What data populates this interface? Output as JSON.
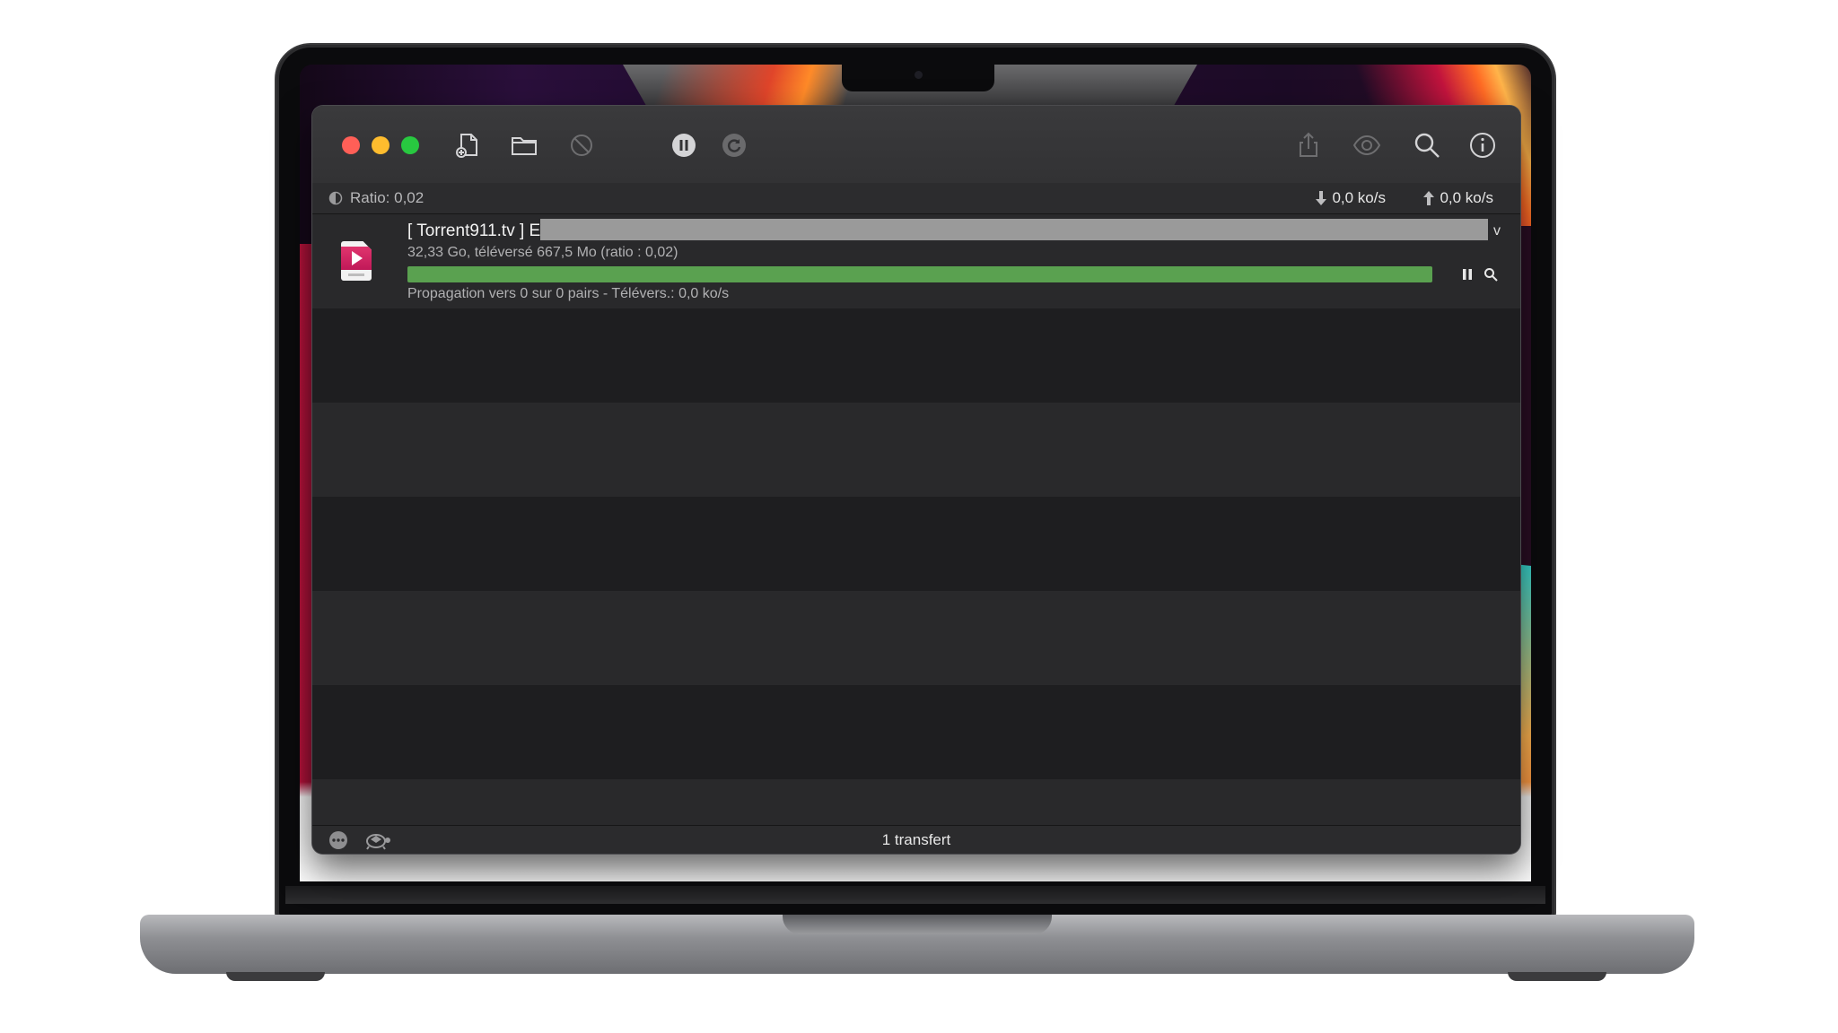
{
  "toolbar": {
    "icons": [
      "open-torrent-icon",
      "open-folder-icon",
      "remove-icon",
      "pause-all-icon",
      "resume-all-icon",
      "share-icon",
      "quicklook-icon",
      "search-icon",
      "info-icon"
    ]
  },
  "status_bar": {
    "ratio_label": "Ratio: 0,02",
    "download_speed": "0,0 ko/s",
    "upload_speed": "0,0 ko/s"
  },
  "transfers": [
    {
      "name": "[ Torrent911.tv ] E",
      "name_tail": "v",
      "info": "32,33 Go, téléversé 667,5 Mo (ratio : 0,02)",
      "progress_percent": 100,
      "progress_color": "#5aa150",
      "status": "Propagation vers 0 sur 0 pairs - Télévers.: 0,0 ko/s"
    }
  ],
  "bottom_bar": {
    "count_label": "1 transfert"
  },
  "colors": {
    "close": "#ff5f57",
    "minimize": "#febc2e",
    "maximize": "#28c840"
  }
}
